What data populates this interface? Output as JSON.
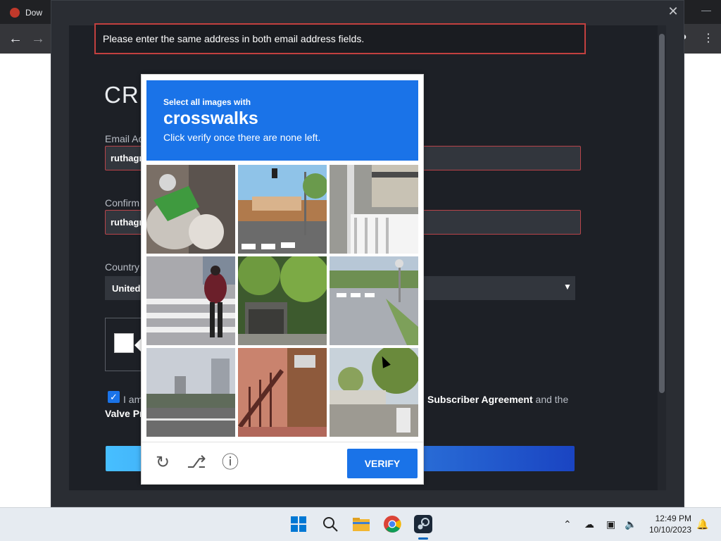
{
  "browser": {
    "tab_title": "Dow",
    "minimize_glyph": "—"
  },
  "steam_dialog": {
    "error_message": "Please enter the same address in both email address fields.",
    "title": "CRE",
    "email_label": "Email Ac",
    "email_value": "ruthagr",
    "confirm_label": "Confirm",
    "confirm_value": "ruthagr",
    "country_label": "Country",
    "country_value": "United",
    "agree_prefix": "I am",
    "agree_link1": "Subscriber Agreement",
    "agree_mid": "and the",
    "agree_link2": "Valve Pr",
    "agree_checked": true
  },
  "recaptcha": {
    "instruction_small": "Select all images with",
    "instruction_target": "crosswalks",
    "instruction_sub": "Click verify once there are none left.",
    "verify_label": "VERIFY",
    "icons": [
      "reload-icon",
      "audio-icon",
      "info-icon"
    ],
    "accent_color": "#1a73e8"
  },
  "taskbar": {
    "time": "12:49 PM",
    "date": "10/10/2023",
    "apps": [
      "start-icon",
      "search-icon",
      "file-explorer-icon",
      "chrome-icon",
      "steam-icon"
    ]
  }
}
